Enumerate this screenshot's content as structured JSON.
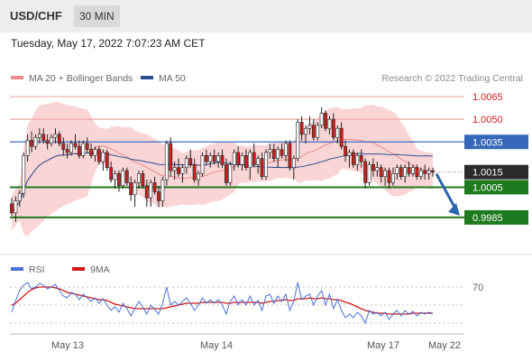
{
  "header": {
    "symbol": "USD/CHF",
    "interval": "30 MIN",
    "timestamp": "Tuesday, May 17, 2022 7:07:23 AM CET"
  },
  "chart_data": {
    "type": "candlestick",
    "legend_main": [
      {
        "name": "MA 20 + Bollinger Bands",
        "color": "#f08a8a"
      },
      {
        "name": "MA 50",
        "color": "#2e4f8f"
      }
    ],
    "credit": "Research © 2022 Trading Central",
    "last_price": "1.0015",
    "ylim": [
      0.997,
      1.0074
    ],
    "levels": [
      {
        "label": "1.0065",
        "value": 1.0065,
        "kind": "resistance"
      },
      {
        "label": "1.0050",
        "value": 1.005,
        "kind": "resistance"
      },
      {
        "label": "1.0035",
        "value": 1.0035,
        "kind": "pivot"
      },
      {
        "label": "1.0005",
        "value": 1.0005,
        "kind": "support"
      },
      {
        "label": "0.9985",
        "value": 0.9985,
        "kind": "support"
      }
    ],
    "x_ticks": [
      "May 13",
      "May 14",
      "May 17",
      "May 22"
    ],
    "arrow_direction": "down",
    "candles": [
      [
        0.9994,
        0.9998,
        0.9986,
        0.9988
      ],
      [
        0.9988,
        0.9999,
        0.9982,
        0.9996
      ],
      [
        0.9996,
        1.0003,
        0.9992,
        1.0001
      ],
      [
        1.0001,
        1.0028,
        0.9998,
        1.0026
      ],
      [
        1.0026,
        1.004,
        1.0022,
        1.0036
      ],
      [
        1.0036,
        1.0042,
        1.0028,
        1.0032
      ],
      [
        1.0032,
        1.004,
        1.003,
        1.0038
      ],
      [
        1.0038,
        1.0044,
        1.0034,
        1.004
      ],
      [
        1.004,
        1.0044,
        1.0034,
        1.0036
      ],
      [
        1.0036,
        1.004,
        1.003,
        1.0034
      ],
      [
        1.0034,
        1.004,
        1.0032,
        1.0038
      ],
      [
        1.0038,
        1.0044,
        1.0034,
        1.004
      ],
      [
        1.004,
        1.0042,
        1.0032,
        1.0034
      ],
      [
        1.0034,
        1.0038,
        1.0026,
        1.003
      ],
      [
        1.003,
        1.0034,
        1.0024,
        1.0028
      ],
      [
        1.0028,
        1.0036,
        1.0026,
        1.0034
      ],
      [
        1.0034,
        1.004,
        1.003,
        1.0032
      ],
      [
        1.0032,
        1.0036,
        1.0024,
        1.0026
      ],
      [
        1.0026,
        1.0036,
        1.0024,
        1.0034
      ],
      [
        1.0034,
        1.0038,
        1.0028,
        1.003
      ],
      [
        1.003,
        1.0034,
        1.0024,
        1.0026
      ],
      [
        1.0026,
        1.0032,
        1.0022,
        1.003
      ],
      [
        1.003,
        1.0032,
        1.002,
        1.0022
      ],
      [
        1.0022,
        1.003,
        1.0016,
        1.0028
      ],
      [
        1.0028,
        1.003,
        1.0016,
        1.0018
      ],
      [
        1.0018,
        1.0022,
        1.0008,
        1.001
      ],
      [
        1.001,
        1.0016,
        1.0004,
        1.0014
      ],
      [
        1.0014,
        1.0016,
        1.0002,
        1.0006
      ],
      [
        1.0006,
        1.0018,
        1.0004,
        1.0016
      ],
      [
        1.0016,
        1.0018,
        1.0006,
        1.0008
      ],
      [
        1.0008,
        1.0012,
        0.9996,
        1.0
      ],
      [
        1.0,
        1.001,
        0.9992,
        1.0008
      ],
      [
        1.0008,
        1.0016,
        1.0004,
        1.0014
      ],
      [
        1.0014,
        1.0016,
        1.0004,
        1.0006
      ],
      [
        1.0006,
        1.001,
        0.9992,
        0.9998
      ],
      [
        0.9998,
        1.001,
        0.9992,
        1.0008
      ],
      [
        1.0008,
        1.0012,
        1.0,
        1.0002
      ],
      [
        1.0002,
        1.0006,
        0.9992,
        0.9996
      ],
      [
        0.9996,
        1.0012,
        0.9992,
        1.001
      ],
      [
        1.001,
        1.0036,
        1.0006,
        1.0034
      ],
      [
        1.0034,
        1.0038,
        1.0012,
        1.0016
      ],
      [
        1.0016,
        1.0022,
        1.001,
        1.0018
      ],
      [
        1.0018,
        1.0024,
        1.0012,
        1.0014
      ],
      [
        1.0014,
        1.002,
        1.0008,
        1.0018
      ],
      [
        1.0018,
        1.0026,
        1.0014,
        1.0024
      ],
      [
        1.0024,
        1.003,
        1.0018,
        1.002
      ],
      [
        1.002,
        1.0024,
        1.0008,
        1.001
      ],
      [
        1.001,
        1.0016,
        1.0006,
        1.0014
      ],
      [
        1.0014,
        1.0028,
        1.0012,
        1.0026
      ],
      [
        1.0026,
        1.003,
        1.002,
        1.0022
      ],
      [
        1.0022,
        1.0028,
        1.0018,
        1.0026
      ],
      [
        1.0026,
        1.003,
        1.002,
        1.0022
      ],
      [
        1.0022,
        1.0028,
        1.0018,
        1.0026
      ],
      [
        1.0026,
        1.003,
        1.0018,
        1.002
      ],
      [
        1.002,
        1.0024,
        1.0006,
        1.0008
      ],
      [
        1.0008,
        1.0022,
        1.0006,
        1.002
      ],
      [
        1.002,
        1.003,
        1.0016,
        1.0028
      ],
      [
        1.0028,
        1.0032,
        1.0018,
        1.002
      ],
      [
        1.002,
        1.0028,
        1.0016,
        1.0026
      ],
      [
        1.0026,
        1.003,
        1.0016,
        1.0018
      ],
      [
        1.0018,
        1.003,
        1.001,
        1.0028
      ],
      [
        1.0028,
        1.0034,
        1.0018,
        1.002
      ],
      [
        1.002,
        1.0026,
        1.0014,
        1.0024
      ],
      [
        1.0024,
        1.0028,
        1.001,
        1.0012
      ],
      [
        1.0012,
        1.003,
        1.001,
        1.0028
      ],
      [
        1.0028,
        1.0034,
        1.0024,
        1.003
      ],
      [
        1.003,
        1.0034,
        1.0022,
        1.0024
      ],
      [
        1.0024,
        1.0032,
        1.0018,
        1.003
      ],
      [
        1.003,
        1.0034,
        1.0024,
        1.0026
      ],
      [
        1.0026,
        1.0036,
        1.0022,
        1.0034
      ],
      [
        1.0034,
        1.0036,
        1.0016,
        1.0018
      ],
      [
        1.0018,
        1.0026,
        1.001,
        1.0024
      ],
      [
        1.0024,
        1.005,
        1.0022,
        1.0048
      ],
      [
        1.0048,
        1.0052,
        1.0036,
        1.004
      ],
      [
        1.004,
        1.0046,
        1.0034,
        1.0044
      ],
      [
        1.0044,
        1.0052,
        1.004,
        1.0046
      ],
      [
        1.0046,
        1.005,
        1.0036,
        1.0038
      ],
      [
        1.0038,
        1.0048,
        1.0036,
        1.0046
      ],
      [
        1.0046,
        1.0058,
        1.0044,
        1.0054
      ],
      [
        1.0054,
        1.0056,
        1.0042,
        1.0044
      ],
      [
        1.0044,
        1.0052,
        1.004,
        1.005
      ],
      [
        1.005,
        1.0054,
        1.0036,
        1.0038
      ],
      [
        1.0038,
        1.0046,
        1.0034,
        1.0044
      ],
      [
        1.0044,
        1.0048,
        1.003,
        1.0032
      ],
      [
        1.0032,
        1.0036,
        1.0022,
        1.0026
      ],
      [
        1.0026,
        1.003,
        1.0018,
        1.0028
      ],
      [
        1.0028,
        1.003,
        1.0018,
        1.002
      ],
      [
        1.002,
        1.0028,
        1.0016,
        1.0026
      ],
      [
        1.0026,
        1.003,
        1.0018,
        1.0022
      ],
      [
        1.0022,
        1.0024,
        1.0004,
        1.0008
      ],
      [
        1.0008,
        1.0022,
        1.0006,
        1.002
      ],
      [
        1.002,
        1.0024,
        1.0012,
        1.0016
      ],
      [
        1.0016,
        1.0022,
        1.0012,
        1.0018
      ],
      [
        1.0018,
        1.002,
        1.0008,
        1.0012
      ],
      [
        1.0012,
        1.0018,
        1.0006,
        1.0016
      ],
      [
        1.0016,
        1.0018,
        1.0004,
        1.0008
      ],
      [
        1.0008,
        1.0018,
        1.0006,
        1.0014
      ],
      [
        1.0014,
        1.002,
        1.001,
        1.0018
      ],
      [
        1.0018,
        1.002,
        1.001,
        1.0012
      ],
      [
        1.0012,
        1.002,
        1.0008,
        1.0018
      ],
      [
        1.0018,
        1.0022,
        1.0012,
        1.0014
      ],
      [
        1.0014,
        1.002,
        1.0012,
        1.0018
      ],
      [
        1.0018,
        1.002,
        1.001,
        1.0012
      ],
      [
        1.0012,
        1.0018,
        1.001,
        1.0016
      ],
      [
        1.0016,
        1.002,
        1.001,
        1.0014
      ],
      [
        1.0014,
        1.0018,
        1.001,
        1.0016
      ],
      [
        1.0016,
        1.0018,
        1.0012,
        1.0015
      ]
    ],
    "rsi_panel": {
      "legend": [
        {
          "name": "RSI",
          "color": "#4a72d6"
        },
        {
          "name": "9MA",
          "color": "#d01818"
        }
      ],
      "ylim": [
        20,
        80
      ],
      "tick_labels": [
        "70"
      ],
      "rsi": [
        42,
        55,
        66,
        72,
        75,
        68,
        70,
        74,
        72,
        68,
        70,
        73,
        66,
        60,
        58,
        64,
        62,
        56,
        62,
        58,
        54,
        58,
        52,
        57,
        50,
        44,
        48,
        42,
        52,
        46,
        38,
        46,
        54,
        48,
        40,
        50,
        45,
        40,
        52,
        70,
        50,
        54,
        50,
        54,
        58,
        52,
        44,
        50,
        58,
        52,
        56,
        52,
        56,
        50,
        40,
        54,
        60,
        50,
        56,
        50,
        60,
        50,
        55,
        44,
        60,
        62,
        52,
        60,
        54,
        62,
        44,
        54,
        75,
        56,
        60,
        62,
        50,
        60,
        66,
        50,
        62,
        46,
        56,
        44,
        36,
        40,
        36,
        42,
        38,
        30,
        44,
        40,
        42,
        38,
        42,
        34,
        40,
        44,
        38,
        44,
        40,
        43,
        38,
        42,
        40,
        42,
        41
      ],
      "ma": [
        50,
        52,
        56,
        60,
        64,
        67,
        69,
        70,
        70,
        70,
        70,
        69,
        68,
        66,
        64,
        63,
        62,
        61,
        60,
        59,
        58,
        57,
        56,
        56,
        55,
        53,
        51,
        50,
        49,
        48,
        47,
        46,
        46,
        46,
        46,
        46,
        46,
        46,
        46,
        47,
        48,
        49,
        50,
        51,
        52,
        52,
        52,
        52,
        53,
        53,
        53,
        53,
        53,
        53,
        52,
        52,
        53,
        53,
        53,
        53,
        53,
        53,
        53,
        52,
        53,
        54,
        54,
        55,
        55,
        56,
        55,
        55,
        57,
        57,
        57,
        58,
        57,
        57,
        58,
        57,
        57,
        56,
        56,
        55,
        53,
        52,
        50,
        48,
        46,
        44,
        43,
        42,
        41,
        41,
        41,
        40,
        40,
        40,
        40,
        40,
        40,
        41,
        41,
        41,
        41,
        41,
        41
      ]
    }
  }
}
